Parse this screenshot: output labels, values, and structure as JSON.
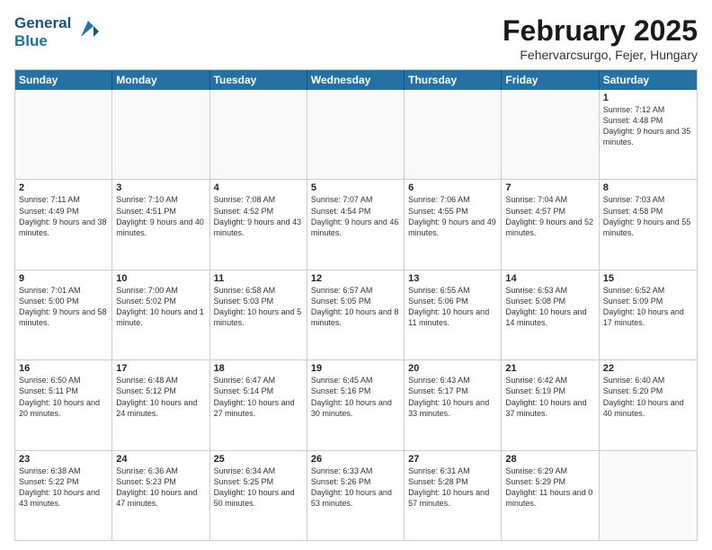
{
  "header": {
    "logo_line1": "General",
    "logo_line2": "Blue",
    "month_title": "February 2025",
    "location": "Fehervarcsurgo, Fejer, Hungary"
  },
  "weekdays": [
    "Sunday",
    "Monday",
    "Tuesday",
    "Wednesday",
    "Thursday",
    "Friday",
    "Saturday"
  ],
  "rows": [
    [
      {
        "day": "",
        "info": ""
      },
      {
        "day": "",
        "info": ""
      },
      {
        "day": "",
        "info": ""
      },
      {
        "day": "",
        "info": ""
      },
      {
        "day": "",
        "info": ""
      },
      {
        "day": "",
        "info": ""
      },
      {
        "day": "1",
        "info": "Sunrise: 7:12 AM\nSunset: 4:48 PM\nDaylight: 9 hours and 35 minutes."
      }
    ],
    [
      {
        "day": "2",
        "info": "Sunrise: 7:11 AM\nSunset: 4:49 PM\nDaylight: 9 hours and 38 minutes."
      },
      {
        "day": "3",
        "info": "Sunrise: 7:10 AM\nSunset: 4:51 PM\nDaylight: 9 hours and 40 minutes."
      },
      {
        "day": "4",
        "info": "Sunrise: 7:08 AM\nSunset: 4:52 PM\nDaylight: 9 hours and 43 minutes."
      },
      {
        "day": "5",
        "info": "Sunrise: 7:07 AM\nSunset: 4:54 PM\nDaylight: 9 hours and 46 minutes."
      },
      {
        "day": "6",
        "info": "Sunrise: 7:06 AM\nSunset: 4:55 PM\nDaylight: 9 hours and 49 minutes."
      },
      {
        "day": "7",
        "info": "Sunrise: 7:04 AM\nSunset: 4:57 PM\nDaylight: 9 hours and 52 minutes."
      },
      {
        "day": "8",
        "info": "Sunrise: 7:03 AM\nSunset: 4:58 PM\nDaylight: 9 hours and 55 minutes."
      }
    ],
    [
      {
        "day": "9",
        "info": "Sunrise: 7:01 AM\nSunset: 5:00 PM\nDaylight: 9 hours and 58 minutes."
      },
      {
        "day": "10",
        "info": "Sunrise: 7:00 AM\nSunset: 5:02 PM\nDaylight: 10 hours and 1 minute."
      },
      {
        "day": "11",
        "info": "Sunrise: 6:58 AM\nSunset: 5:03 PM\nDaylight: 10 hours and 5 minutes."
      },
      {
        "day": "12",
        "info": "Sunrise: 6:57 AM\nSunset: 5:05 PM\nDaylight: 10 hours and 8 minutes."
      },
      {
        "day": "13",
        "info": "Sunrise: 6:55 AM\nSunset: 5:06 PM\nDaylight: 10 hours and 11 minutes."
      },
      {
        "day": "14",
        "info": "Sunrise: 6:53 AM\nSunset: 5:08 PM\nDaylight: 10 hours and 14 minutes."
      },
      {
        "day": "15",
        "info": "Sunrise: 6:52 AM\nSunset: 5:09 PM\nDaylight: 10 hours and 17 minutes."
      }
    ],
    [
      {
        "day": "16",
        "info": "Sunrise: 6:50 AM\nSunset: 5:11 PM\nDaylight: 10 hours and 20 minutes."
      },
      {
        "day": "17",
        "info": "Sunrise: 6:48 AM\nSunset: 5:12 PM\nDaylight: 10 hours and 24 minutes."
      },
      {
        "day": "18",
        "info": "Sunrise: 6:47 AM\nSunset: 5:14 PM\nDaylight: 10 hours and 27 minutes."
      },
      {
        "day": "19",
        "info": "Sunrise: 6:45 AM\nSunset: 5:16 PM\nDaylight: 10 hours and 30 minutes."
      },
      {
        "day": "20",
        "info": "Sunrise: 6:43 AM\nSunset: 5:17 PM\nDaylight: 10 hours and 33 minutes."
      },
      {
        "day": "21",
        "info": "Sunrise: 6:42 AM\nSunset: 5:19 PM\nDaylight: 10 hours and 37 minutes."
      },
      {
        "day": "22",
        "info": "Sunrise: 6:40 AM\nSunset: 5:20 PM\nDaylight: 10 hours and 40 minutes."
      }
    ],
    [
      {
        "day": "23",
        "info": "Sunrise: 6:38 AM\nSunset: 5:22 PM\nDaylight: 10 hours and 43 minutes."
      },
      {
        "day": "24",
        "info": "Sunrise: 6:36 AM\nSunset: 5:23 PM\nDaylight: 10 hours and 47 minutes."
      },
      {
        "day": "25",
        "info": "Sunrise: 6:34 AM\nSunset: 5:25 PM\nDaylight: 10 hours and 50 minutes."
      },
      {
        "day": "26",
        "info": "Sunrise: 6:33 AM\nSunset: 5:26 PM\nDaylight: 10 hours and 53 minutes."
      },
      {
        "day": "27",
        "info": "Sunrise: 6:31 AM\nSunset: 5:28 PM\nDaylight: 10 hours and 57 minutes."
      },
      {
        "day": "28",
        "info": "Sunrise: 6:29 AM\nSunset: 5:29 PM\nDaylight: 11 hours and 0 minutes."
      },
      {
        "day": "",
        "info": ""
      }
    ]
  ]
}
